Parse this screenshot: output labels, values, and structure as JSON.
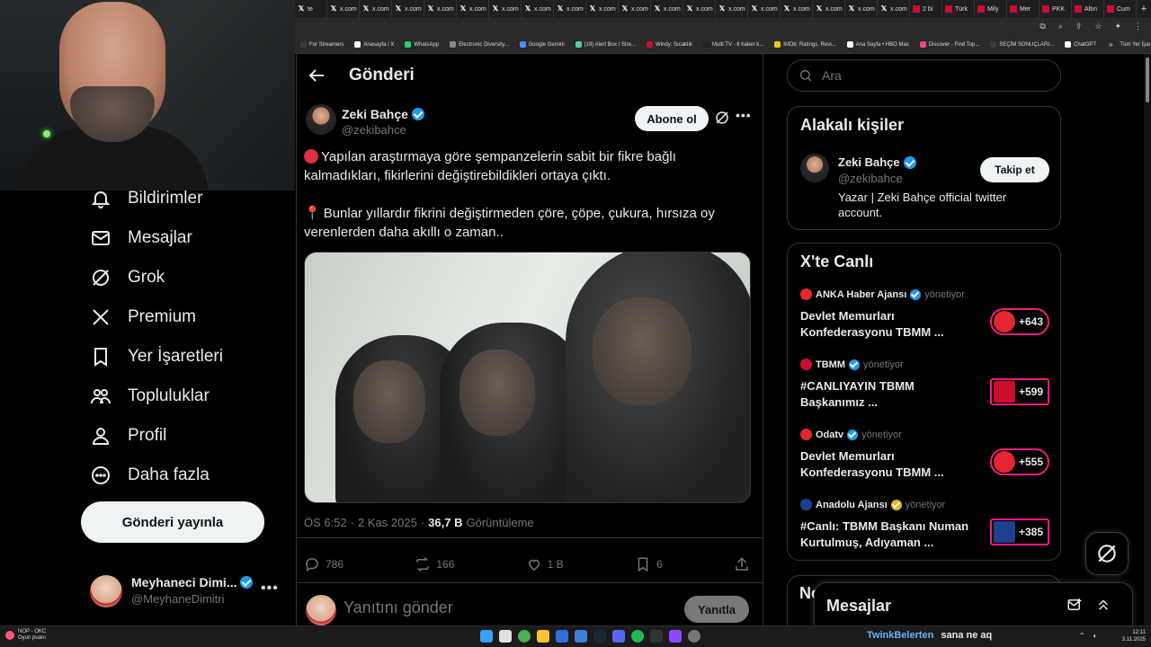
{
  "browser": {
    "tabs": [
      {
        "label": "te",
        "icon": "x-icon"
      },
      {
        "label": "x.com",
        "icon": "x-icon"
      },
      {
        "label": "x.com",
        "icon": "x-icon"
      },
      {
        "label": "x.com",
        "icon": "x-icon"
      },
      {
        "label": "x.com",
        "icon": "x-icon"
      },
      {
        "label": "x.com",
        "icon": "x-icon"
      },
      {
        "label": "x.com",
        "icon": "x-icon"
      },
      {
        "label": "x.com",
        "icon": "x-icon"
      },
      {
        "label": "x.com",
        "icon": "x-icon"
      },
      {
        "label": "x.com",
        "icon": "x-icon"
      },
      {
        "label": "x.com",
        "icon": "x-icon"
      },
      {
        "label": "x.com",
        "icon": "x-icon"
      },
      {
        "label": "x.com",
        "icon": "x-icon"
      },
      {
        "label": "x.com",
        "icon": "x-icon"
      },
      {
        "label": "x.com",
        "icon": "x-icon"
      },
      {
        "label": "x.com",
        "icon": "x-icon"
      },
      {
        "label": "x.com",
        "icon": "x-icon"
      },
      {
        "label": "x.com",
        "icon": "x-icon"
      },
      {
        "label": "x.com",
        "icon": "x-icon"
      },
      {
        "label": "2 bi",
        "icon": "news-icon"
      },
      {
        "label": "Türk",
        "icon": "news-icon"
      },
      {
        "label": "Mily",
        "icon": "news-icon"
      },
      {
        "label": "Mer",
        "icon": "news-icon"
      },
      {
        "label": "PKK",
        "icon": "news-icon"
      },
      {
        "label": "Altın",
        "icon": "news-icon"
      },
      {
        "label": "Cum",
        "icon": "news-icon"
      }
    ],
    "bookmarks": [
      {
        "label": "For Streamers",
        "color": "#3a3a3a"
      },
      {
        "label": "Anasayfa / X",
        "color": "#ffffff"
      },
      {
        "label": "WhatsApp",
        "color": "#25d366"
      },
      {
        "label": "Electronic Diversity...",
        "color": "#888888"
      },
      {
        "label": "Google Gemini",
        "color": "#4c8df6"
      },
      {
        "label": "(19) Alert Box / Stre...",
        "color": "#53d2a1"
      },
      {
        "label": "Windy: Sıcaklık",
        "color": "#c8102e"
      },
      {
        "label": "Multi TV - 6 haber k...",
        "color": "#222222"
      },
      {
        "label": "IMDb: Ratings, Revi...",
        "color": "#f5c518"
      },
      {
        "label": "Ana Sayfa • HBO Max",
        "color": "#ffffff"
      },
      {
        "label": "Discover - Find Top...",
        "color": "#e64a8a"
      },
      {
        "label": "SEÇİM SONUÇLARI...",
        "color": "#3a3a3a"
      },
      {
        "label": "ChatGPT",
        "color": "#ffffff"
      }
    ],
    "bookmarks_more": "»",
    "all_bookmarks": "Tüm Yer İşaretleri"
  },
  "sidebar": {
    "items": [
      {
        "label": "Bildirimler",
        "icon": "bell-icon"
      },
      {
        "label": "Mesajlar",
        "icon": "mail-icon"
      },
      {
        "label": "Grok",
        "icon": "grok-icon"
      },
      {
        "label": "Premium",
        "icon": "x-logo-icon"
      },
      {
        "label": "Yer İşaretleri",
        "icon": "bookmark-icon"
      },
      {
        "label": "Topluluklar",
        "icon": "communities-icon"
      },
      {
        "label": "Profil",
        "icon": "profile-icon"
      },
      {
        "label": "Daha fazla",
        "icon": "more-circle-icon"
      }
    ],
    "post_button": "Gönderi yayınla",
    "account": {
      "name": "Meyhaneci Dimi...",
      "handle": "@MeyhaneDimitri"
    }
  },
  "post": {
    "header_title": "Gönderi",
    "author": {
      "name": "Zeki Bahçe",
      "handle": "@zekibahce"
    },
    "subscribe_label": "Abone ol",
    "paragraph1": "Yapılan araştırmaya göre şempanzelerin sabit bir fikre bağlı kalmadıkları, fikirlerini değiştirebildikleri ortaya çıktı.",
    "paragraph2": "Bunlar yıllardır fikrini değiştirmeden çöre, çöpe, çukura, hırsıza oy verenlerden daha akıllı o zaman..",
    "time": "ÖS 6:52",
    "sep": "·",
    "date": "2 Kas 2025",
    "views_count": "36,7 B",
    "views_label": "Görüntüleme",
    "replies": "786",
    "reposts": "166",
    "likes": "1 B",
    "bookmarks": "6",
    "reply_placeholder": "Yanıtını gönder",
    "reply_button": "Yanıtla"
  },
  "right": {
    "search_placeholder": "Ara",
    "related": {
      "title": "Alakalı kişiler",
      "name": "Zeki Bahçe",
      "handle": "@zekibahce",
      "bio": "Yazar | Zeki Bahçe official twitter account.",
      "follow_label": "Takip et"
    },
    "live": {
      "title": "X'te Canlı",
      "items": [
        {
          "source": "ANKA Haber Ajansı",
          "verified": "blue",
          "role": "yönetiyor",
          "title": "Devlet Memurları Konfederasyonu TBMM ...",
          "count": "+643",
          "color": "#e3262f"
        },
        {
          "source": "TBMM",
          "verified": "blue",
          "role": "yönetiyor",
          "title": "#CANLIYAYIN  TBMM Başkanımız ...",
          "count": "+599",
          "color": "#c8102e"
        },
        {
          "source": "Odatv",
          "verified": "blue",
          "role": "yönetiyor",
          "title": "Devlet Memurları Konfederasyonu TBMM ...",
          "count": "+555",
          "color": "#e3262f"
        },
        {
          "source": "Anadolu Ajansı",
          "verified": "gold",
          "role": "yönetiyor",
          "title": "#Canlı: TBMM Başkanı Numan Kurtulmuş, Adıyaman ...",
          "count": "+385",
          "color": "#1c3f8f"
        }
      ]
    },
    "truncated_heading": "Ne",
    "messages_label": "Mesajlar"
  },
  "taskbar": {
    "weather_line1": "NOP - OKC",
    "weather_line2": "Oyun puanı",
    "now_playing_artist": "TwinkBelerten",
    "now_playing_title": "sana ne aq",
    "time": "12:11",
    "date": "3.11.2025"
  },
  "colors": {
    "accent": "#1d9bf0",
    "live_border": "#f91880",
    "background": "#000000",
    "muted": "#71767b"
  }
}
